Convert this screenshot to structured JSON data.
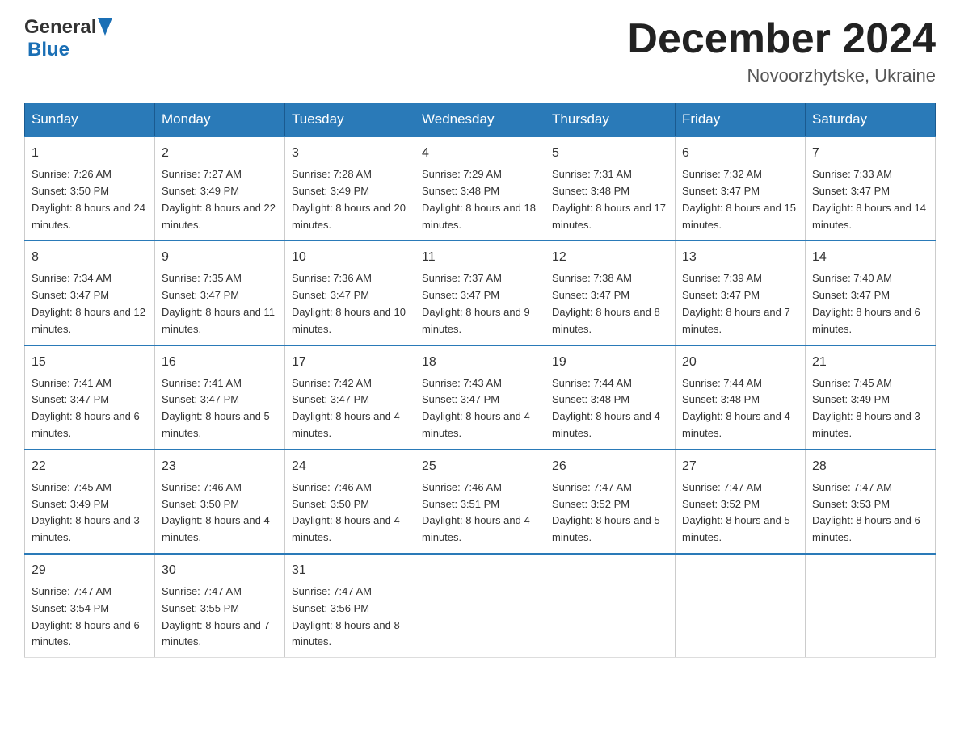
{
  "header": {
    "logo_general": "General",
    "logo_blue": "Blue",
    "month_title": "December 2024",
    "location": "Novoorzhytske, Ukraine"
  },
  "weekdays": [
    "Sunday",
    "Monday",
    "Tuesday",
    "Wednesday",
    "Thursday",
    "Friday",
    "Saturday"
  ],
  "weeks": [
    [
      {
        "day": "1",
        "sunrise": "7:26 AM",
        "sunset": "3:50 PM",
        "daylight": "8 hours and 24 minutes."
      },
      {
        "day": "2",
        "sunrise": "7:27 AM",
        "sunset": "3:49 PM",
        "daylight": "8 hours and 22 minutes."
      },
      {
        "day": "3",
        "sunrise": "7:28 AM",
        "sunset": "3:49 PM",
        "daylight": "8 hours and 20 minutes."
      },
      {
        "day": "4",
        "sunrise": "7:29 AM",
        "sunset": "3:48 PM",
        "daylight": "8 hours and 18 minutes."
      },
      {
        "day": "5",
        "sunrise": "7:31 AM",
        "sunset": "3:48 PM",
        "daylight": "8 hours and 17 minutes."
      },
      {
        "day": "6",
        "sunrise": "7:32 AM",
        "sunset": "3:47 PM",
        "daylight": "8 hours and 15 minutes."
      },
      {
        "day": "7",
        "sunrise": "7:33 AM",
        "sunset": "3:47 PM",
        "daylight": "8 hours and 14 minutes."
      }
    ],
    [
      {
        "day": "8",
        "sunrise": "7:34 AM",
        "sunset": "3:47 PM",
        "daylight": "8 hours and 12 minutes."
      },
      {
        "day": "9",
        "sunrise": "7:35 AM",
        "sunset": "3:47 PM",
        "daylight": "8 hours and 11 minutes."
      },
      {
        "day": "10",
        "sunrise": "7:36 AM",
        "sunset": "3:47 PM",
        "daylight": "8 hours and 10 minutes."
      },
      {
        "day": "11",
        "sunrise": "7:37 AM",
        "sunset": "3:47 PM",
        "daylight": "8 hours and 9 minutes."
      },
      {
        "day": "12",
        "sunrise": "7:38 AM",
        "sunset": "3:47 PM",
        "daylight": "8 hours and 8 minutes."
      },
      {
        "day": "13",
        "sunrise": "7:39 AM",
        "sunset": "3:47 PM",
        "daylight": "8 hours and 7 minutes."
      },
      {
        "day": "14",
        "sunrise": "7:40 AM",
        "sunset": "3:47 PM",
        "daylight": "8 hours and 6 minutes."
      }
    ],
    [
      {
        "day": "15",
        "sunrise": "7:41 AM",
        "sunset": "3:47 PM",
        "daylight": "8 hours and 6 minutes."
      },
      {
        "day": "16",
        "sunrise": "7:41 AM",
        "sunset": "3:47 PM",
        "daylight": "8 hours and 5 minutes."
      },
      {
        "day": "17",
        "sunrise": "7:42 AM",
        "sunset": "3:47 PM",
        "daylight": "8 hours and 4 minutes."
      },
      {
        "day": "18",
        "sunrise": "7:43 AM",
        "sunset": "3:47 PM",
        "daylight": "8 hours and 4 minutes."
      },
      {
        "day": "19",
        "sunrise": "7:44 AM",
        "sunset": "3:48 PM",
        "daylight": "8 hours and 4 minutes."
      },
      {
        "day": "20",
        "sunrise": "7:44 AM",
        "sunset": "3:48 PM",
        "daylight": "8 hours and 4 minutes."
      },
      {
        "day": "21",
        "sunrise": "7:45 AM",
        "sunset": "3:49 PM",
        "daylight": "8 hours and 3 minutes."
      }
    ],
    [
      {
        "day": "22",
        "sunrise": "7:45 AM",
        "sunset": "3:49 PM",
        "daylight": "8 hours and 3 minutes."
      },
      {
        "day": "23",
        "sunrise": "7:46 AM",
        "sunset": "3:50 PM",
        "daylight": "8 hours and 4 minutes."
      },
      {
        "day": "24",
        "sunrise": "7:46 AM",
        "sunset": "3:50 PM",
        "daylight": "8 hours and 4 minutes."
      },
      {
        "day": "25",
        "sunrise": "7:46 AM",
        "sunset": "3:51 PM",
        "daylight": "8 hours and 4 minutes."
      },
      {
        "day": "26",
        "sunrise": "7:47 AM",
        "sunset": "3:52 PM",
        "daylight": "8 hours and 5 minutes."
      },
      {
        "day": "27",
        "sunrise": "7:47 AM",
        "sunset": "3:52 PM",
        "daylight": "8 hours and 5 minutes."
      },
      {
        "day": "28",
        "sunrise": "7:47 AM",
        "sunset": "3:53 PM",
        "daylight": "8 hours and 6 minutes."
      }
    ],
    [
      {
        "day": "29",
        "sunrise": "7:47 AM",
        "sunset": "3:54 PM",
        "daylight": "8 hours and 6 minutes."
      },
      {
        "day": "30",
        "sunrise": "7:47 AM",
        "sunset": "3:55 PM",
        "daylight": "8 hours and 7 minutes."
      },
      {
        "day": "31",
        "sunrise": "7:47 AM",
        "sunset": "3:56 PM",
        "daylight": "8 hours and 8 minutes."
      },
      null,
      null,
      null,
      null
    ]
  ]
}
